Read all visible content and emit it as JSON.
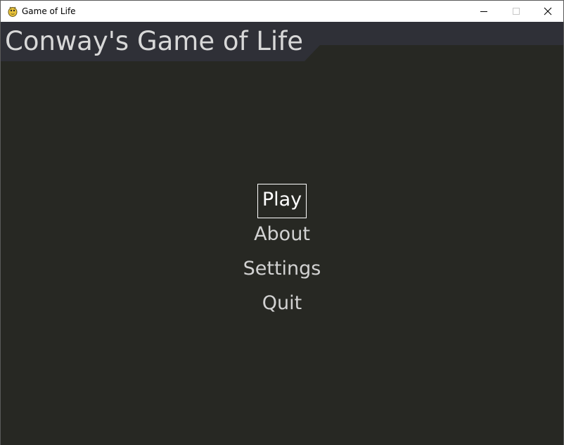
{
  "window": {
    "title": "Game of Life",
    "icon": "pygame-snake-icon",
    "controls": [
      "minimize-icon",
      "maximize-icon",
      "close-icon"
    ]
  },
  "header": {
    "title": "Conway's Game of Life"
  },
  "menu": {
    "items": [
      {
        "label": "Play",
        "selected": true
      },
      {
        "label": "About",
        "selected": false
      },
      {
        "label": "Settings",
        "selected": false
      },
      {
        "label": "Quit",
        "selected": false
      }
    ]
  },
  "colors": {
    "background": "#272823",
    "header_banner": "#2f3037",
    "text": "#d2d2d2",
    "selected_text": "#ffffff"
  }
}
